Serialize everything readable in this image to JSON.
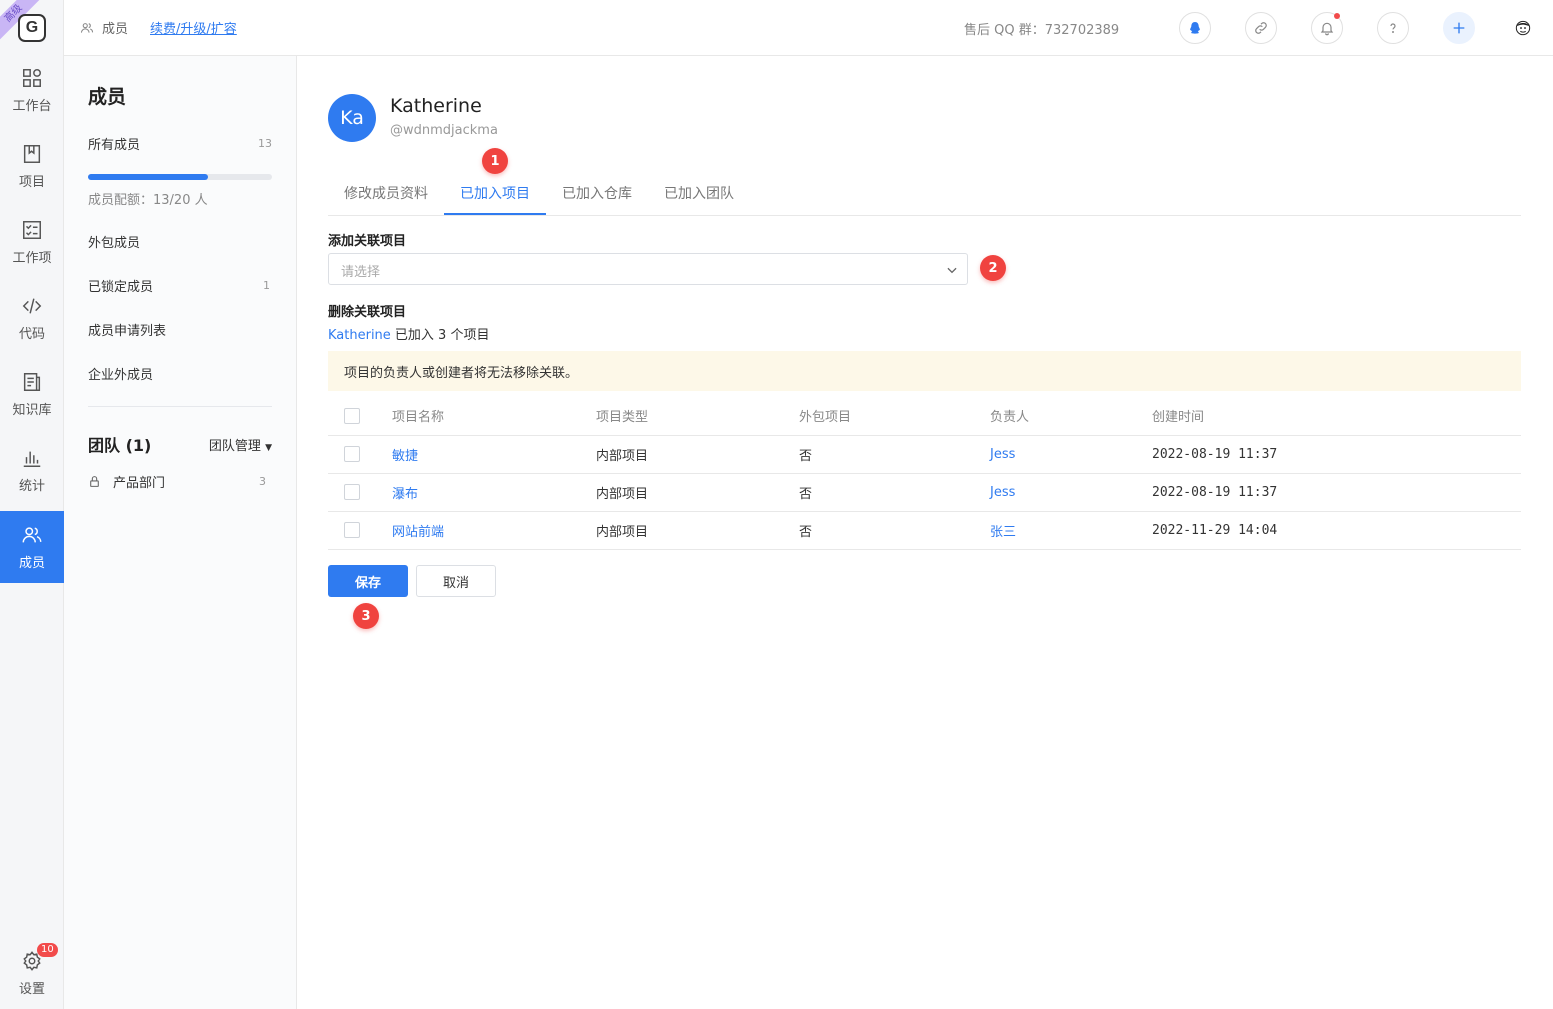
{
  "rail": {
    "corner_tag": "高级",
    "logo": "G",
    "items": [
      {
        "label": "工作台",
        "icon": "grid-icon"
      },
      {
        "label": "项目",
        "icon": "book-icon"
      },
      {
        "label": "工作项",
        "icon": "checklist-icon"
      },
      {
        "label": "代码",
        "icon": "code-icon"
      },
      {
        "label": "知识库",
        "icon": "document-icon"
      },
      {
        "label": "统计",
        "icon": "chart-icon"
      },
      {
        "label": "成员",
        "icon": "members-icon",
        "active": true
      }
    ],
    "settings": {
      "label": "设置",
      "badge": "10",
      "icon": "gear-icon"
    }
  },
  "topbar": {
    "breadcrumb": "成员",
    "renew_link": "续费/升级/扩容",
    "support": "售后 QQ 群：732702389",
    "icons": [
      "qq-icon",
      "link-icon",
      "bell-icon",
      "help-icon",
      "plus-icon",
      "user-avatar"
    ]
  },
  "sidebar": {
    "title": "成员",
    "all_members": {
      "label": "所有成员",
      "count": "13"
    },
    "quota": {
      "text": "成员配额：13/20 人",
      "used": 13,
      "total": 20
    },
    "outsourced": "外包成员",
    "locked": {
      "label": "已锁定成员",
      "count": "1"
    },
    "applications": "成员申请列表",
    "external": "企业外成员",
    "teams": {
      "title": "团队 (1)",
      "manage": "团队管理",
      "items": [
        {
          "label": "产品部门",
          "count": "3"
        }
      ]
    }
  },
  "user": {
    "initials": "Ka",
    "name": "Katherine",
    "handle": "@wdnmdjackma"
  },
  "tabs": [
    "修改成员资料",
    "已加入项目",
    "已加入仓库",
    "已加入团队"
  ],
  "active_tab": 1,
  "add_section": {
    "title": "添加关联项目",
    "placeholder": "请选择"
  },
  "remove_section": {
    "title": "删除关联项目",
    "user_ref": "Katherine",
    "summary": " 已加入 3 个项目"
  },
  "notice": "项目的负责人或创建者将无法移除关联。",
  "table": {
    "headers": [
      "项目名称",
      "项目类型",
      "外包项目",
      "负责人",
      "创建时间"
    ],
    "rows": [
      [
        "敏捷",
        "内部项目",
        "否",
        "Jess",
        "2022-08-19 11:37"
      ],
      [
        "瀑布",
        "内部项目",
        "否",
        "Jess",
        "2022-08-19 11:37"
      ],
      [
        "网站前端",
        "内部项目",
        "否",
        "张三",
        "2022-11-29 14:04"
      ]
    ]
  },
  "buttons": {
    "save": "保存",
    "cancel": "取消"
  },
  "steps": [
    "1",
    "2",
    "3"
  ],
  "colors": {
    "accent": "#2f7bf0",
    "step": "#f0433f",
    "notice_bg": "#fdf8e8"
  }
}
